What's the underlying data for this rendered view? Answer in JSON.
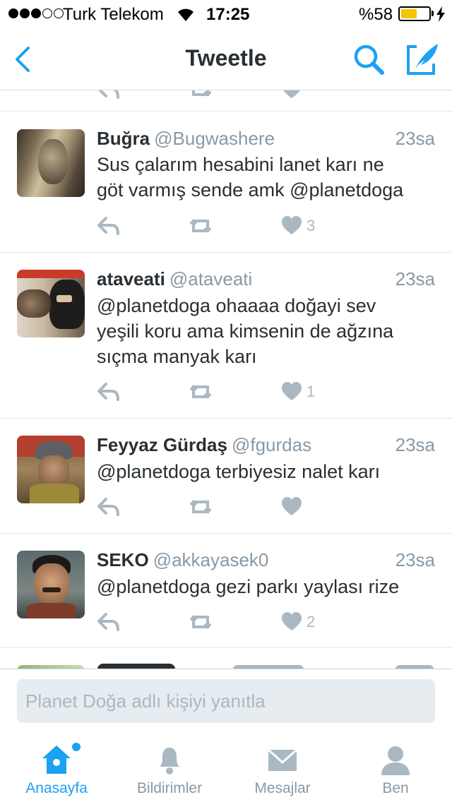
{
  "status_bar": {
    "carrier": "Turk Telekom",
    "time": "17:25",
    "battery_text": "%58",
    "battery_level": 0.58,
    "signal_strength": 3,
    "signal_max": 5
  },
  "header": {
    "title": "Tweetle",
    "icons": [
      "back-icon",
      "search-icon",
      "compose-icon"
    ]
  },
  "colors": {
    "accent": "#1da1f2",
    "text": "#292f33",
    "muted": "#8899a6",
    "action_gray": "#aab8c2"
  },
  "tweets": [
    {
      "name": "Buğra",
      "handle": "@Bugwashere",
      "time": "23sa",
      "lines": [
        "Sus çalarım hesabini lanet karı ne",
        "göt varmış sende amk @planetdoga"
      ],
      "likes": "3"
    },
    {
      "name": "ataveati",
      "handle": "@ataveati",
      "time": "23sa",
      "lines": [
        "@planetdoga ohaaaa doğayi sev",
        "yeşili koru ama kimsenin de ağzına",
        "sıçma manyak karı"
      ],
      "likes": "1"
    },
    {
      "name": "Feyyaz Gürdaş",
      "handle": "@fgurdas",
      "time": "23sa",
      "lines": [
        "@planetdoga terbiyesiz nalet karı"
      ],
      "likes": ""
    },
    {
      "name": "SEKO",
      "handle": "@akkayasek0",
      "time": "23sa",
      "lines": [
        "@planetdoga gezi parkı yaylası rize"
      ],
      "likes": "2"
    }
  ],
  "reply": {
    "placeholder": "Planet Doğa adlı kişiyi yanıtla"
  },
  "tabs": [
    {
      "label": "Anasayfa",
      "icon": "home-icon",
      "active": true
    },
    {
      "label": "Bildirimler",
      "icon": "bell-icon",
      "active": false
    },
    {
      "label": "Mesajlar",
      "icon": "envelope-icon",
      "active": false
    },
    {
      "label": "Ben",
      "icon": "person-icon",
      "active": false
    }
  ]
}
